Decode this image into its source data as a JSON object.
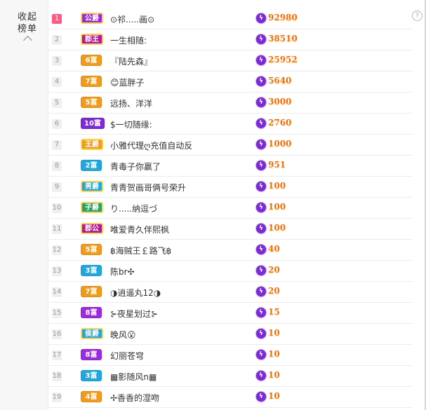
{
  "panel": {
    "collapse_label": "收起榜单"
  },
  "icons": {
    "help": "?",
    "coin": "ϟ"
  },
  "rows": [
    {
      "rank": "1",
      "badge": "公爵",
      "badge_color": "#9b2ae0",
      "badge_kind": "noble",
      "name": "⊙祁.....画⊙",
      "score": "92980"
    },
    {
      "rank": "2",
      "badge": "郡王",
      "badge_color": "#b5179e",
      "badge_kind": "noble",
      "name": "一生相随:",
      "score": "38510"
    },
    {
      "rank": "3",
      "badge": "6富",
      "badge_color": "#f39a1a",
      "badge_kind": "rich",
      "name": "『陆先森』",
      "score": "25952"
    },
    {
      "rank": "4",
      "badge": "7富",
      "badge_color": "#f39a1a",
      "badge_kind": "rich",
      "name": "😊蓝胖子",
      "score": "5640"
    },
    {
      "rank": "5",
      "badge": "5富",
      "badge_color": "#f39a1a",
      "badge_kind": "rich",
      "name": "远扬、洋洋",
      "score": "3000"
    },
    {
      "rank": "6",
      "badge": "10富",
      "badge_color": "#7b29d9",
      "badge_kind": "rich",
      "name": "$一切随缘:",
      "score": "2760"
    },
    {
      "rank": "7",
      "badge": "王爵",
      "badge_color": "#f39a1a",
      "badge_kind": "noble",
      "name": "小雅代理ღ充值自动反",
      "score": "1000"
    },
    {
      "rank": "8",
      "badge": "2富",
      "badge_color": "#1ea7e1",
      "badge_kind": "rich",
      "name": "青毒子你赢了",
      "score": "951"
    },
    {
      "rank": "9",
      "badge": "男爵",
      "badge_color": "#1ea7e1",
      "badge_kind": "noble",
      "name": "青青贺画哥俩号荣升",
      "score": "100"
    },
    {
      "rank": "10",
      "badge": "子爵",
      "badge_color": "#26a26b",
      "badge_kind": "noble",
      "name": "り.....纳逗づ",
      "score": "100"
    },
    {
      "rank": "11",
      "badge": "郡公",
      "badge_color": "#b5179e",
      "badge_kind": "noble",
      "name": "唯爱青久伴熙枫",
      "score": "100"
    },
    {
      "rank": "12",
      "badge": "5富",
      "badge_color": "#f39a1a",
      "badge_kind": "rich",
      "name": "฿海贼王￡路飞฿",
      "score": "40"
    },
    {
      "rank": "13",
      "badge": "3富",
      "badge_color": "#1ea7e1",
      "badge_kind": "rich",
      "name": "陈br✣",
      "score": "20"
    },
    {
      "rank": "14",
      "badge": "7富",
      "badge_color": "#f39a1a",
      "badge_kind": "rich",
      "name": "◑逍遥丸12◑",
      "score": "20"
    },
    {
      "rank": "15",
      "badge": "8富",
      "badge_color": "#9b2ae0",
      "badge_kind": "rich",
      "name": "⊱夜星划过⊱",
      "score": "15"
    },
    {
      "rank": "16",
      "badge": "侯爵",
      "badge_color": "#1ea7e1",
      "badge_kind": "noble",
      "name": "晚风😮",
      "score": "10"
    },
    {
      "rank": "17",
      "badge": "8富",
      "badge_color": "#9b2ae0",
      "badge_kind": "rich",
      "name": "幻丽苍穹",
      "score": "10"
    },
    {
      "rank": "18",
      "badge": "3富",
      "badge_color": "#1ea7e1",
      "badge_kind": "rich",
      "name": "▦影随风n▦",
      "score": "10"
    },
    {
      "rank": "19",
      "badge": "4富",
      "badge_color": "#f39a1a",
      "badge_kind": "rich",
      "name": "✢香香的湿吻",
      "score": "10"
    }
  ]
}
